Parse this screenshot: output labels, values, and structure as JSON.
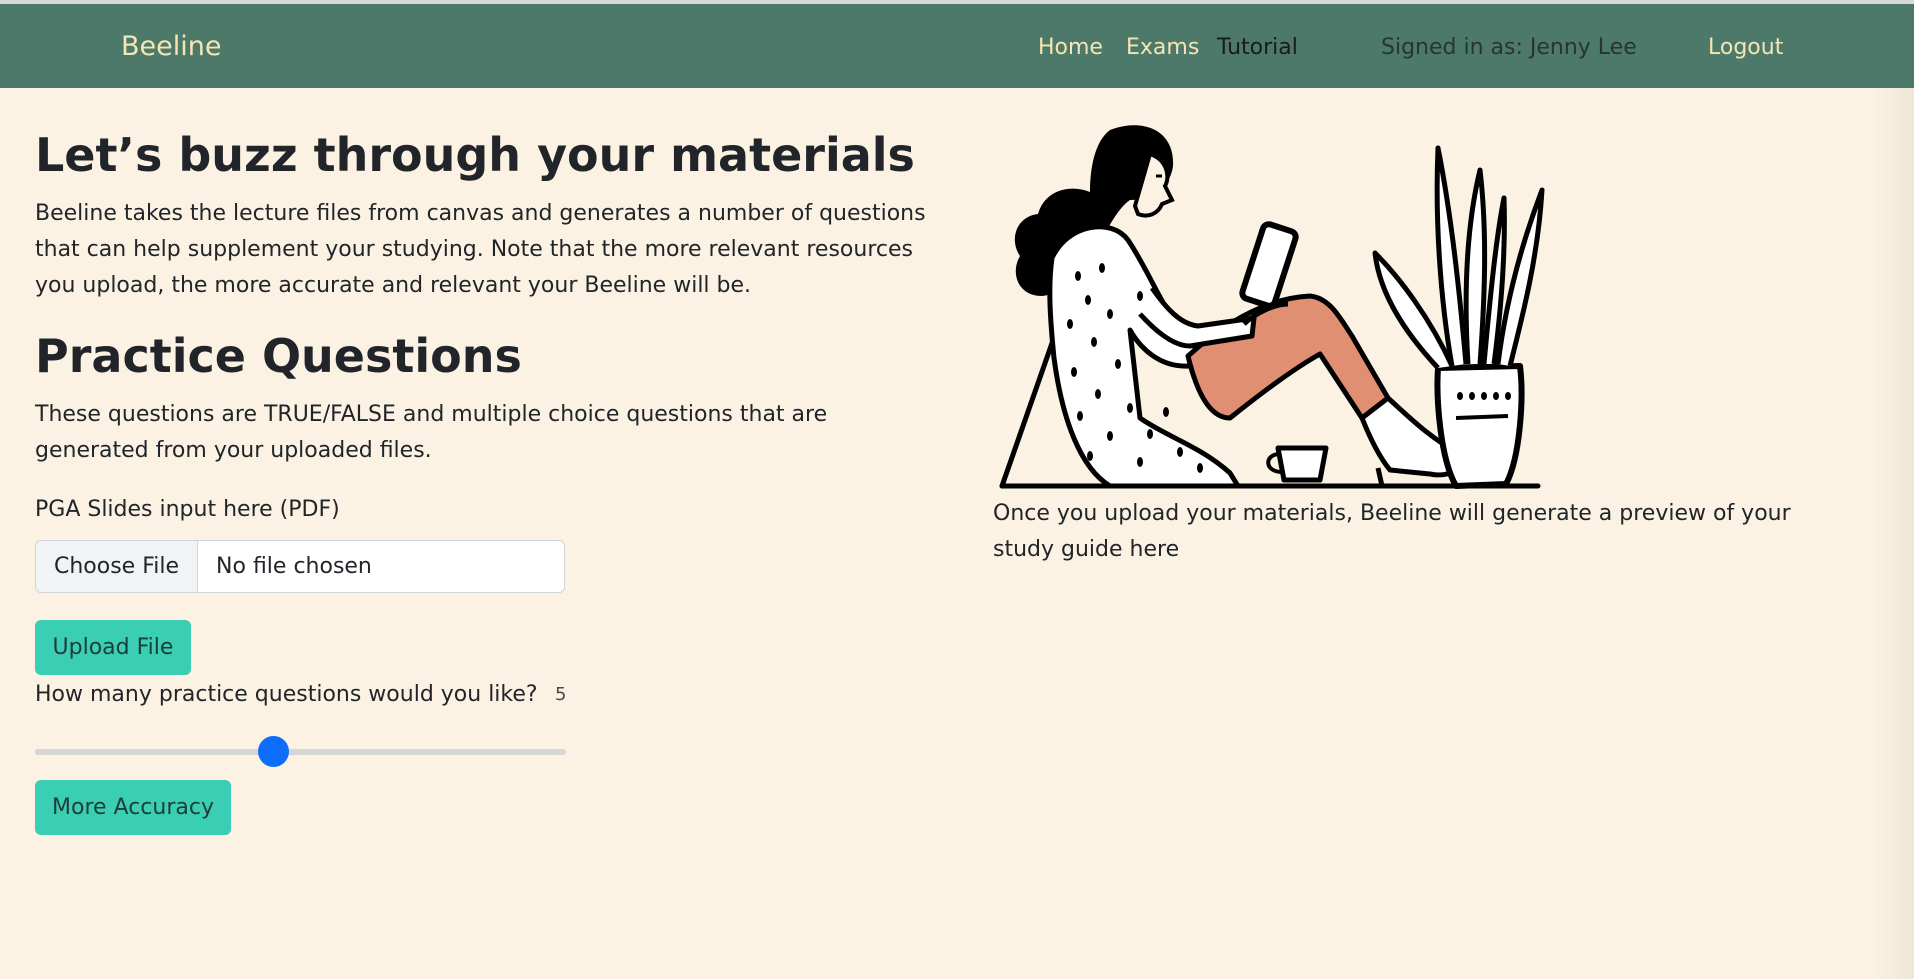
{
  "nav": {
    "brand": "Beeline",
    "links": [
      "Home",
      "Exams",
      "Tutorial"
    ],
    "active": "Tutorial",
    "signed_in": "Signed in as: Jenny Lee",
    "logout": "Logout"
  },
  "intro": {
    "title": "Let’s buzz through your materials",
    "text": "Beeline takes the lecture files from canvas and generates a number of questions that can help supplement your studying. Note that the more relevant resources you upload, the more accurate and relevant your Beeline will be."
  },
  "practice": {
    "title": "Practice Questions",
    "text": "These questions are TRUE/FALSE and multiple choice questions that are generated from your uploaded files."
  },
  "upload": {
    "label": "PGA Slides input here (PDF)",
    "choose_button": "Choose File",
    "file_status": "No file chosen",
    "upload_button": "Upload File"
  },
  "questions": {
    "label": "How many practice questions would you like?",
    "value": "5",
    "slider_fraction": 0.45
  },
  "accuracy_button": "More Accuracy",
  "preview_text": "Once you upload your materials, Beeline will generate a preview of your study guide here",
  "colors": {
    "navbar": "#4c7969",
    "nav_text": "#f6e5b4",
    "background": "#fbf2e3",
    "button": "#3acfb4",
    "slider_thumb": "#0d6efd",
    "pants": "#e08f73"
  }
}
